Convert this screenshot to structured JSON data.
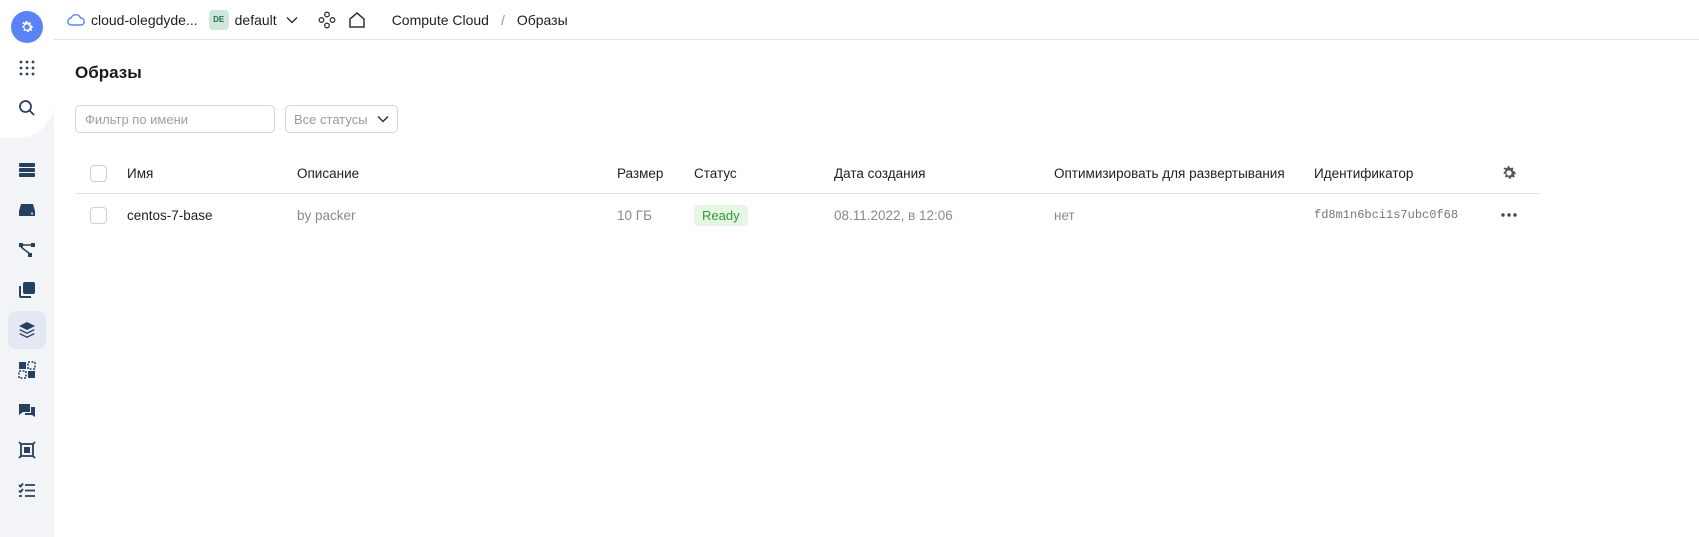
{
  "header": {
    "cloud_name": "cloud-olegdyde...",
    "folder_badge": "DE",
    "folder_name": "default",
    "breadcrumb_service": "Compute Cloud",
    "breadcrumb_separator": "/",
    "breadcrumb_page": "Образы"
  },
  "sidebar": {
    "items": [
      {
        "icon": "logo-gear-icon"
      },
      {
        "icon": "services-grid-icon"
      },
      {
        "icon": "search-icon"
      },
      {
        "icon": "servers-icon"
      },
      {
        "icon": "disks-icon"
      },
      {
        "icon": "network-icon"
      },
      {
        "icon": "snapshots-icon"
      },
      {
        "icon": "images-icon",
        "active": true
      },
      {
        "icon": "placement-icon"
      },
      {
        "icon": "instance-groups-icon"
      },
      {
        "icon": "dedicated-hosts-icon"
      },
      {
        "icon": "operations-icon"
      }
    ]
  },
  "main": {
    "title": "Образы",
    "filter_placeholder": "Фильтр по имени",
    "status_filter": "Все статусы"
  },
  "table": {
    "columns": {
      "name": "Имя",
      "description": "Описание",
      "size": "Размер",
      "status": "Статус",
      "created": "Дата создания",
      "optimize": "Оптимизировать для развертывания",
      "id": "Идентификатор"
    },
    "rows": [
      {
        "name": "centos-7-base",
        "description": "by packer",
        "size": "10 ГБ",
        "status": "Ready",
        "created": "08.11.2022, в 12:06",
        "optimize": "нет",
        "id": "fd8m1n6bci1s7ubc0f68"
      }
    ]
  },
  "colors": {
    "accent": "#5b83f5",
    "rail_bg": "#f2f4f8",
    "status_ready_bg": "#e6f6e5",
    "status_ready_text": "#2f9a2f",
    "icon": "#27405e"
  }
}
